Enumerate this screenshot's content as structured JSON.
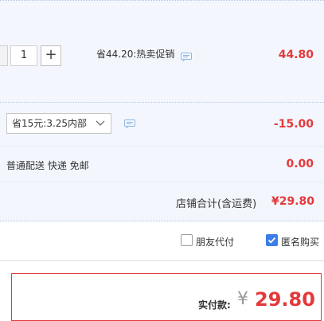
{
  "item": {
    "quantity": "1",
    "plus_label": "+",
    "promo_text": "省44.20:热卖促销",
    "price": "44.80"
  },
  "coupon": {
    "selected": "省15元:3.25内部",
    "amount": "-15.00"
  },
  "shipping": {
    "text": "普通配送 快递 免邮",
    "amount": "0.00"
  },
  "store_total": {
    "label": "店铺合计(含运费)",
    "value": "¥29.80"
  },
  "options": {
    "friend_pay_label": "朋友代付",
    "anonymous_label": "匿名购买",
    "friend_pay_checked": false,
    "anonymous_checked": true
  },
  "payment": {
    "label": "实付款:",
    "currency": "¥",
    "amount": "29.80"
  },
  "colors": {
    "price_red": "#e4393c",
    "panel_bg": "#f3f7fd",
    "checkbox_blue": "#3d7de8"
  },
  "icons": [
    "chat-bubble-icon",
    "chevron-down-icon",
    "check-icon"
  ]
}
